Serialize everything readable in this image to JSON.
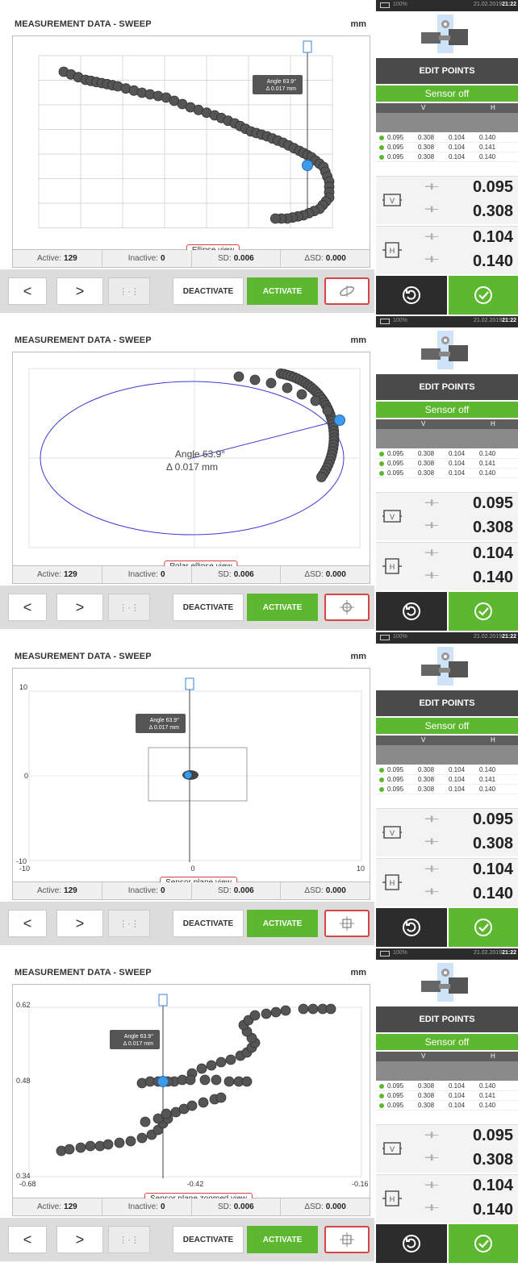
{
  "common": {
    "title": "MEASUREMENT DATA - SWEEP",
    "unit": "mm",
    "stats": {
      "active_label": "Active:",
      "active_value": "129",
      "inactive_label": "Inactive:",
      "inactive_value": "0",
      "sd_label": "SD:",
      "sd_value": "0.006",
      "dsd_label": "ΔSD:",
      "dsd_value": "0.000"
    },
    "buttons": {
      "prev": "<",
      "next": ">",
      "deactivate": "DEACTIVATE",
      "activate": "ACTIVATE"
    },
    "annotation": {
      "angle": "Angle 63.9°",
      "delta": "Δ 0.017 mm"
    },
    "colors": {
      "accent_green": "#5cb82f",
      "highlight_blue": "#3d9be9",
      "point_grey": "#555555",
      "ellipse_blue": "#3a3ad6",
      "view_frame_red": "#d64545"
    },
    "side": {
      "battery": "100%",
      "date": "21.02.2019",
      "time": "21:22",
      "edit_points": "EDIT POINTS",
      "sensor": "Sensor off",
      "v": "V",
      "h": "H",
      "rows": [
        [
          "0.095",
          "0.308",
          "0.104",
          "0.140"
        ],
        [
          "0.095",
          "0.308",
          "0.104",
          "0.141"
        ],
        [
          "0.095",
          "0.308",
          "0.104",
          "0.140"
        ]
      ],
      "v_top": "0.095",
      "v_bottom": "0.308",
      "h_top": "0.104",
      "h_bottom": "0.140",
      "v_icon_letter": "V",
      "h_icon_letter": "H",
      "icons": {
        "undo": "undo-icon",
        "confirm": "checkmark-icon",
        "machine": "machine-train-icon"
      }
    }
  },
  "views": [
    {
      "label": "Ellipse view",
      "view_icon": "ellipse-view-icon"
    },
    {
      "label": "Polar ellipse view",
      "view_icon": "crosshair-icon"
    },
    {
      "label": "Sensor plane view",
      "view_icon": "sensor-plane-icon",
      "axes": {
        "y_top": "10",
        "y_mid": "0",
        "y_bottom": "-10",
        "x_left": "-10",
        "x_mid": "0",
        "x_right": "10"
      }
    },
    {
      "label": "Sensor plane zoomed view",
      "view_icon": "sensor-plane-icon",
      "axes": {
        "y_top": "0.62",
        "y_mid": "0.48",
        "y_bottom": "0.34",
        "x_left": "-0.68",
        "x_mid": "-0.42",
        "x_right": "-0.16"
      }
    }
  ]
}
